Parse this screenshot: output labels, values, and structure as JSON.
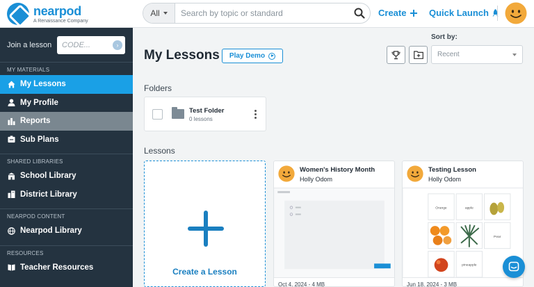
{
  "brand": {
    "name": "nearpod",
    "tagline": "A Renaissance Company",
    "accent_color": "#1a8fd6"
  },
  "header": {
    "search_type": "All",
    "search_placeholder": "Search by topic or standard",
    "create_label": "Create",
    "quick_launch_label": "Quick Launch",
    "icons": [
      "search-icon",
      "plus-icon",
      "rocket-icon",
      "avatar-icon"
    ]
  },
  "sidebar": {
    "join_label": "Join a lesson",
    "code_placeholder": "CODE...",
    "sections": [
      {
        "label": "MY MATERIALS"
      },
      {
        "label": "SHARED LIBRARIES"
      },
      {
        "label": "NEARPOD CONTENT"
      },
      {
        "label": "RESOURCES"
      }
    ],
    "items": [
      {
        "label": "My Lessons",
        "icon": "home-icon",
        "state": "active"
      },
      {
        "label": "My Profile",
        "icon": "user-icon",
        "state": "normal"
      },
      {
        "label": "Reports",
        "icon": "bar-chart-icon",
        "state": "hover"
      },
      {
        "label": "Sub Plans",
        "icon": "sub-plans-icon",
        "state": "normal"
      },
      {
        "label": "School Library",
        "icon": "school-icon",
        "state": "normal"
      },
      {
        "label": "District Library",
        "icon": "district-icon",
        "state": "normal"
      },
      {
        "label": "Nearpod Library",
        "icon": "globe-icon",
        "state": "normal"
      },
      {
        "label": "Teacher Resources",
        "icon": "book-icon",
        "state": "normal"
      }
    ]
  },
  "main": {
    "title": "My Lessons",
    "play_demo_label": "Play Demo",
    "sort_label": "Sort by:",
    "sort_value": "Recent",
    "folders_title": "Folders",
    "lessons_title": "Lessons",
    "folder": {
      "name": "Test Folder",
      "count": "0 lessons"
    },
    "create_label": "Create a Lesson",
    "lessons": [
      {
        "title": "Women's History Month",
        "author": "Holly Odom",
        "meta": "Oct 4, 2024 - 4 MB"
      },
      {
        "title": "Testing Lesson",
        "author": "Holly Odom",
        "meta": "Jun 18, 2024 - 3 MB"
      }
    ],
    "thumb_words": [
      "Orange",
      "apple",
      "Pear",
      "pineapple"
    ]
  }
}
